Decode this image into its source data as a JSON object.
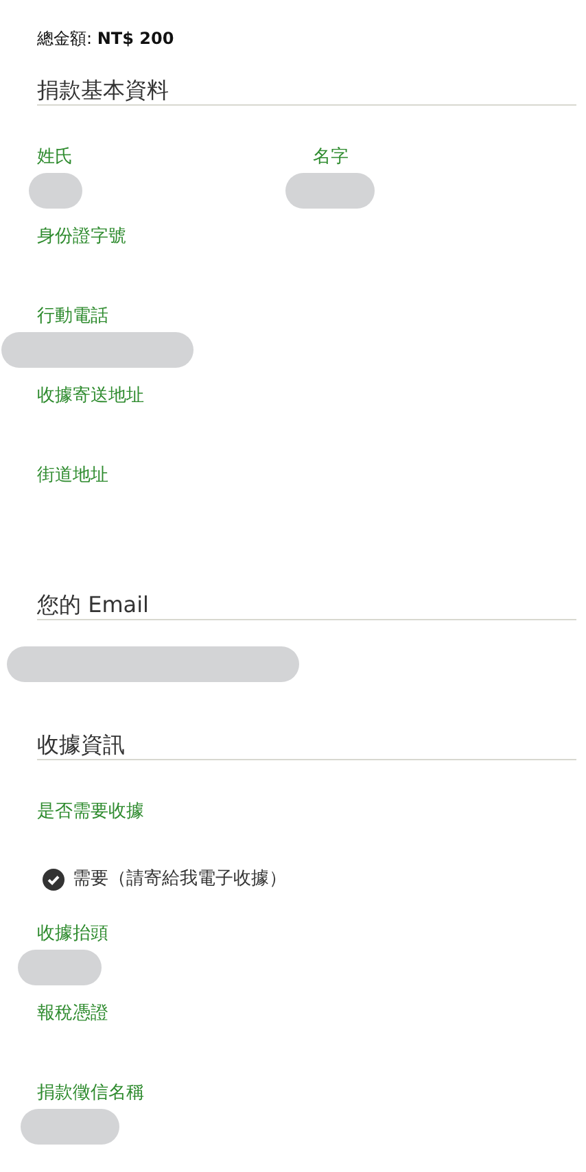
{
  "total": {
    "label": "總金額:",
    "amount": "NT$ 200"
  },
  "sections": [
    {
      "title": "捐款基本資料",
      "fields": [
        {
          "kind": "row",
          "fields": [
            {
              "kind": "text",
              "label": "姓氏",
              "redacted": true
            },
            {
              "kind": "text",
              "label": "名字",
              "redacted": true
            }
          ]
        },
        {
          "kind": "text",
          "label": "身份證字號"
        },
        {
          "kind": "text",
          "label": "行動電話",
          "redacted": true
        },
        {
          "kind": "text",
          "label": "收據寄送地址"
        },
        {
          "kind": "text",
          "label": "街道地址"
        }
      ]
    },
    {
      "title": "您的 Email",
      "fields": [
        {
          "kind": "text",
          "redacted": true
        }
      ]
    },
    {
      "title": "收據資訊",
      "fields": [
        {
          "kind": "choice",
          "label": "是否需要收據",
          "options": [
            {
              "label": "需要（請寄給我電子收據）",
              "checked": true
            }
          ]
        },
        {
          "kind": "text",
          "label": "收據抬頭",
          "redacted": true
        },
        {
          "kind": "text",
          "label": "報稅憑證"
        },
        {
          "kind": "text",
          "label": "捐款徵信名稱",
          "redacted": true
        }
      ]
    }
  ]
}
